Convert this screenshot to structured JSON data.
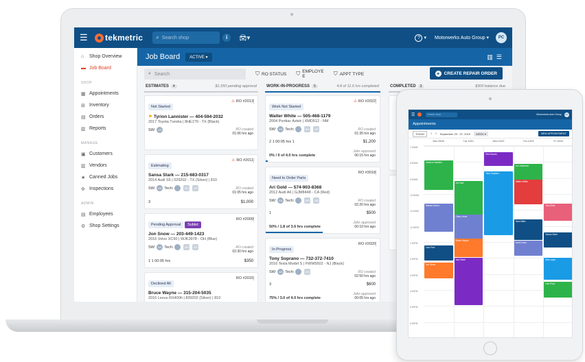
{
  "app": {
    "logo_text": "tekmetric",
    "search_placeholder": "Search shop",
    "org_name": "Motorwerks Auto Group",
    "user_initials": "PC",
    "org_chevron": "▾"
  },
  "sidebar": {
    "items_top": [
      {
        "label": "Shop Overview",
        "icon": "home-icon",
        "glyph": "⌂"
      },
      {
        "label": "Job Board",
        "icon": "car-icon",
        "glyph": "▬",
        "active": true
      }
    ],
    "section_shop": "SHOP",
    "items_shop": [
      {
        "label": "Appointments",
        "icon": "calendar-icon",
        "glyph": "▦"
      },
      {
        "label": "Inventory",
        "icon": "cart-icon",
        "glyph": "⊞"
      },
      {
        "label": "Orders",
        "icon": "orders-icon",
        "glyph": "▤"
      },
      {
        "label": "Reports",
        "icon": "reports-icon",
        "glyph": "▥"
      }
    ],
    "section_manage": "MANAGE",
    "items_manage": [
      {
        "label": "Customers",
        "icon": "customers-icon",
        "glyph": "▣"
      },
      {
        "label": "Vendors",
        "icon": "vendors-icon",
        "glyph": "▥"
      },
      {
        "label": "Canned Jobs",
        "icon": "star-icon",
        "glyph": "★"
      },
      {
        "label": "Inspections",
        "icon": "inspections-icon",
        "glyph": "✣"
      }
    ],
    "section_admin": "ADMIN",
    "items_admin": [
      {
        "label": "Employees",
        "icon": "employees-icon",
        "glyph": "▤"
      },
      {
        "label": "Shop Settings",
        "icon": "gear-icon",
        "glyph": "⚙"
      }
    ]
  },
  "jobboard": {
    "title": "Job Board",
    "filter_active": "ACTIVE ▾",
    "search_placeholder": "Search",
    "filters": [
      "RO STATUS",
      "EMPLOYE",
      "APPT TYPE"
    ],
    "filter_employee_wrap": "E",
    "create_label": "CREATE REPAIR ORDER"
  },
  "columns": {
    "estimates": {
      "title": "ESTIMATES",
      "count": "4",
      "meta": "$1,550 pending approval"
    },
    "wip": {
      "title": "WORK-IN-PROGRESS",
      "count": "5",
      "meta": "4.8 of 11.6 hrs completed"
    },
    "completed": {
      "title": "COMPLETED",
      "count": "3",
      "meta": "$300 balance due"
    }
  },
  "estimate_cards": [
    {
      "status": "Not Started",
      "ro": "RO #2013",
      "customer": "Tyrion Lannister",
      "phone": "404-594-2032",
      "vehicle": "2017 Toyota Tundra | 8HE1?0 - TX (Black)",
      "created_label": "RO created",
      "created": "01:06 hrs ago",
      "sw": "SW:",
      "tech": "",
      "flag": true
    },
    {
      "status": "Estimating",
      "ro": "RO #2011",
      "customer": "Sansa Stark",
      "phone": "215-683-0317",
      "vehicle": "2014 Audi S5 | 029202 - TX (Silver) | 810",
      "created_label": "RO created",
      "created": "01:05 hrs ago",
      "sw": "SW:",
      "tech": "Tech:",
      "tech_initials": "WV",
      "tech2": "AP",
      "bottom_left": "3",
      "price": "$1,000"
    },
    {
      "status": "Pending Approval",
      "extra_tag": "Sublet",
      "ro": "RO #2009",
      "customer": "Jon Snow",
      "phone": "203-449-1423",
      "vehicle": "2016 Volvo XC90 | WJK3978 - OH (Blue)",
      "created_label": "RO created",
      "created": "02:30 hrs ago",
      "sw": "SW:",
      "tech": "Tech:",
      "tech_initials": "WV",
      "tech2": "AP",
      "bottom_left": "1  1  00:05 hrs",
      "price": "$350"
    },
    {
      "status": "Declined All",
      "ro": "RO #2015",
      "customer": "Bruce Wayne",
      "phone": "315-204-5035",
      "vehicle": "2016 Lexus RX400h | 839202 (Silver) | 810",
      "created_label": "RO created",
      "created": "03:00 hrs ago",
      "sw": "SW:",
      "tech": "Tech:",
      "tech_initials": "WV",
      "tech2": "AP"
    }
  ],
  "wip_cards": [
    {
      "status": "Work Not Started",
      "ro": "RO #2022",
      "customer": "Walter White",
      "phone": "505-468-1179",
      "vehicle": "2004 Pontiac Aztek | XMD512 - NM",
      "created_label": "RO created",
      "created": "01:35 hrs ago",
      "sw": "SW:",
      "tech": "Tech:",
      "tech_initials": "WV",
      "tech2": "AP",
      "bottom_left": "2  1  00:05 hrs  1",
      "price": "$1,200",
      "approved_label": "Jobs approved",
      "approved": "00:15 hrs ago",
      "progress_text": "0% / 0 of 4.0 hrs complete",
      "progress": 0.02
    },
    {
      "status": "Need to Order Parts",
      "ro": "RO #3018",
      "customer": "Ari Gold",
      "phone": "574-903-8368",
      "vehicle": "2012 Audi A6 | GJM8448 - CA (Red)",
      "created_label": "RO created",
      "created": "02:20 hrs ago",
      "sw": "SW:",
      "tech": "Tech:",
      "tech_initials": "BR",
      "tech2": "AB",
      "bottom_left": "1",
      "price": "$500",
      "approved_label": "Jobs approved",
      "approved": "00:10 hrs ago",
      "progress_text": "50% / 1.8 of 3.6 hrs complete",
      "progress": 0.5
    },
    {
      "status": "In-Progress",
      "ro": "RO #2020",
      "customer": "Tony Soprano",
      "phone": "732-372-7410",
      "vehicle": "2016 Tesla Model S | FWW9502 - NJ (Black)",
      "created_label": "RO created",
      "created": "02:50 hrs ago",
      "sw": "SW:",
      "tech": "Tech:",
      "tech_initials": "WV",
      "tech2": "",
      "bottom_left": "3",
      "price": "$600",
      "approved_label": "Jobs approved",
      "approved": "00:05 hrs ago",
      "progress_text": "75% / 3.0 of 4.0 hrs complete",
      "progress": 0.75
    }
  ],
  "tablet": {
    "title": "Appointments",
    "today": "TODAY",
    "range": "September 29 - 07, 2019",
    "view": "WEEK ▾",
    "new_appt": "NEW APPOINTMENT",
    "days": [
      "Mon 09/30",
      "Tue 10/01",
      "Wed 10/02",
      "Thu 10/03",
      "Fri 10/04"
    ],
    "hours": [
      "7:00AM",
      "8:00AM",
      "9:00AM",
      "10:00AM",
      "11:00AM",
      "12:00PM",
      "1:00PM",
      "2:00PM",
      "3:00PM",
      "4:00PM",
      "5:00PM",
      "6:00PM"
    ],
    "appointments": [
      {
        "label": "Jessica Hamilton",
        "color": "#2eb34a",
        "day": 0,
        "start": 0.9,
        "len": 1.9
      },
      {
        "label": "Rick Bowen",
        "color": "#7b2bc4",
        "day": 2,
        "start": 0.4,
        "len": 0.9
      },
      {
        "label": "Jon Anderson",
        "color": "#2eb34a",
        "day": 3,
        "start": 1.1,
        "len": 1.3
      },
      {
        "label": "Ari Gold",
        "color": "#2eb34a",
        "day": 1,
        "start": 2.2,
        "len": 2.3
      },
      {
        "label": "Tony Soprano",
        "color": "#1a9be6",
        "day": 2,
        "start": 1.6,
        "len": 4.0
      },
      {
        "label": "Walter White",
        "color": "#e33d3d",
        "day": 3,
        "start": 2.1,
        "len": 1.6
      },
      {
        "label": "Wanda Green",
        "color": "#7080d0",
        "day": 0,
        "start": 3.6,
        "len": 1.8
      },
      {
        "label": "Clara Lewis",
        "color": "#7080d0",
        "day": 1,
        "start": 4.3,
        "len": 1.8
      },
      {
        "label": "Sam Miller",
        "color": "#0f4f85",
        "day": 3,
        "start": 4.6,
        "len": 1.3
      },
      {
        "label": "Tom Kline",
        "color": "#e8607a",
        "day": 4,
        "start": 3.6,
        "len": 1.1
      },
      {
        "label": "Bruce Wayne",
        "color": "#ff7a2b",
        "day": 1,
        "start": 5.8,
        "len": 1.2
      },
      {
        "label": "Kevin Lane",
        "color": "#7080d0",
        "day": 3,
        "start": 5.9,
        "len": 1.0
      },
      {
        "label": "Sansa Stark",
        "color": "#0f4f85",
        "day": 4,
        "start": 5.4,
        "len": 1.0
      },
      {
        "label": "Lisa Ford",
        "color": "#0f4f85",
        "day": 0,
        "start": 6.2,
        "len": 1.0
      },
      {
        "label": "Jon Snow",
        "color": "#ff7a2b",
        "day": 0,
        "start": 7.3,
        "len": 1.0
      },
      {
        "label": "Ned Stark",
        "color": "#7b2bc4",
        "day": 1,
        "start": 7.0,
        "len": 3.0
      },
      {
        "label": "Mia Lopez",
        "color": "#1a9be6",
        "day": 4,
        "start": 7.0,
        "len": 1.4
      },
      {
        "label": "Dan Price",
        "color": "#2eb34a",
        "day": 4,
        "start": 8.5,
        "len": 1.0
      }
    ]
  }
}
